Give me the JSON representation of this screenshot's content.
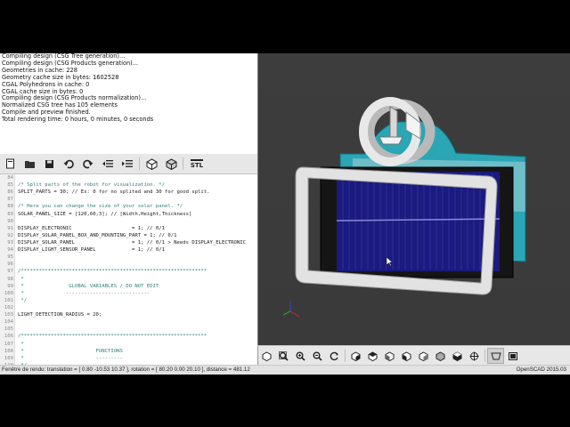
{
  "console": {
    "lines": [
      "Compiling design (CSG Tree generation)...",
      "Compiling design (CSG Products generation)...",
      "Geometries in cache: 228",
      "Geometry cache size in bytes: 1602528",
      "CGAL Polyhedrons in cache: 0",
      "CGAL cache size in bytes: 0",
      "Compiling design (CSG Products normalization)...",
      "Normalized CSG tree has 105 elements",
      "Compile and preview finished.",
      "Total rendering time: 0 hours, 0 minutes, 0 seconds"
    ]
  },
  "editor_toolbar": {
    "stl_label": "STL",
    "icons": [
      "new-file-icon",
      "open-file-icon",
      "save-icon",
      "undo-icon",
      "redo-icon",
      "unindent-icon",
      "indent-icon",
      "preview-icon",
      "render-icon",
      "export-stl-icon"
    ]
  },
  "editor": {
    "lines": [
      {
        "n": "84",
        "t": "",
        "k": "code"
      },
      {
        "n": "85",
        "t": "/* Split parts of the robot for visualization. */",
        "k": "comment"
      },
      {
        "n": "86",
        "t": "SPLIT_PARTS = 30; // Ex: 0 for no splited and 30 for good split.",
        "k": "code"
      },
      {
        "n": "87",
        "t": "",
        "k": "code"
      },
      {
        "n": "88",
        "t": "/* Here you can change the size of your solar panel. */",
        "k": "comment"
      },
      {
        "n": "89",
        "t": "SOLAR_PANEL_SIZE = [120,60,3]; // [Width,Height,Thickness]",
        "k": "code"
      },
      {
        "n": "90",
        "t": "",
        "k": "code"
      },
      {
        "n": "91",
        "t": "DISPLAY_ELECTRONIC                    = 1; // 0/1",
        "k": "code"
      },
      {
        "n": "92",
        "t": "DISPLAY_SOLAR_PANEL_BOX_AND_MOUNTING_PART = 1; // 0/1",
        "k": "code"
      },
      {
        "n": "93",
        "t": "DISPLAY_SOLAR_PANEL                   = 1; // 0/1 > Needs DISPLAY_ELECTRONIC",
        "k": "code"
      },
      {
        "n": "94",
        "t": "DISPLAY_LIGHT_SENSOR_PANEL            = 1; // 0/1",
        "k": "code"
      },
      {
        "n": "95",
        "t": "",
        "k": "code"
      },
      {
        "n": "96",
        "t": "",
        "k": "code"
      },
      {
        "n": "97",
        "t": "/**************************************************************",
        "k": "comment"
      },
      {
        "n": "98",
        "t": " *",
        "k": "comment"
      },
      {
        "n": "99",
        "t": " *               GLOBAL VARIABLES / DO NOT EDIT",
        "k": "comment"
      },
      {
        "n": "100",
        "t": " *              ----------------------------",
        "k": "comment"
      },
      {
        "n": "101",
        "t": " */",
        "k": "comment"
      },
      {
        "n": "102",
        "t": "",
        "k": "code"
      },
      {
        "n": "103",
        "t": "LIGHT_DETECTION_RADIUS = 20;",
        "k": "code"
      },
      {
        "n": "104",
        "t": "",
        "k": "code"
      },
      {
        "n": "105",
        "t": "",
        "k": "code"
      },
      {
        "n": "106",
        "t": "/**************************************************************",
        "k": "comment"
      },
      {
        "n": "107",
        "t": " *",
        "k": "comment"
      },
      {
        "n": "108",
        "t": " *                        FUNCTIONS",
        "k": "comment"
      },
      {
        "n": "109",
        "t": " *                        ---------",
        "k": "comment"
      },
      {
        "n": "110",
        "t": " */",
        "k": "comment"
      }
    ]
  },
  "viewport_toolbar": {
    "icons": [
      "render-preview-icon",
      "view-all-icon",
      "zoom-in-icon",
      "zoom-out-icon",
      "reset-view-icon",
      "view-right-icon",
      "view-top-icon",
      "view-bottom-icon",
      "view-left-icon",
      "view-front-icon",
      "view-back-icon",
      "view-diagonal-icon",
      "view-center-icon",
      "perspective-icon",
      "orthogonal-icon"
    ]
  },
  "status": {
    "left": "Fenêtre de rendu: translation = [ 0.80 -10.53 10.37 ], rotation = [ 80.20 0.00 20.10 ], distance = 481.12",
    "right": "OpenSCAD 2015.03"
  },
  "colors": {
    "teal": "#2aa6b4",
    "frame": "#e2e2e2",
    "panel": "#1b1a7e",
    "viewport_bg": "#3c3c3c",
    "comment": "#2f7f78"
  }
}
